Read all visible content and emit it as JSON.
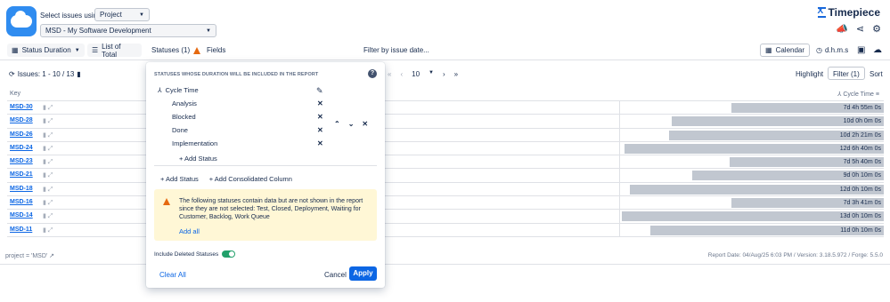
{
  "header": {
    "select_label": "Select issues using",
    "source_select": "Project",
    "project_select": "MSD - My Software Development",
    "brand": "Timepiece"
  },
  "toolbar": {
    "status_duration": "Status Duration",
    "list_of_total": "List of Total",
    "statuses": "Statuses (1)",
    "fields": "Fields",
    "filter_date": "Filter by issue date...",
    "calendar": "Calendar",
    "dhms": "d.h.m.s"
  },
  "issuesbar": {
    "issues": "Issues: 1 - 10 / 13",
    "page_size": "10",
    "highlight": "Highlight",
    "filter": "Filter (1)",
    "sort": "Sort"
  },
  "table": {
    "col_key": "Key",
    "col_cycle": "Cycle Time",
    "rows": [
      {
        "key": "MSD-30",
        "value": "7d 4h 55m 0s",
        "fraction": 0.58
      },
      {
        "key": "MSD-28",
        "value": "10d 0h 0m 0s",
        "fraction": 0.81
      },
      {
        "key": "MSD-26",
        "value": "10d 2h 21m 0s",
        "fraction": 0.82
      },
      {
        "key": "MSD-24",
        "value": "12d 6h 40m 0s",
        "fraction": 0.99
      },
      {
        "key": "MSD-23",
        "value": "7d 5h 40m 0s",
        "fraction": 0.59
      },
      {
        "key": "MSD-21",
        "value": "9d 0h 10m 0s",
        "fraction": 0.73
      },
      {
        "key": "MSD-18",
        "value": "12d 0h 10m 0s",
        "fraction": 0.97
      },
      {
        "key": "MSD-16",
        "value": "7d 3h 41m 0s",
        "fraction": 0.58
      },
      {
        "key": "MSD-14",
        "value": "13d 0h 10m 0s",
        "fraction": 1.0
      },
      {
        "key": "MSD-11",
        "value": "11d 0h 10m 0s",
        "fraction": 0.89
      }
    ]
  },
  "footer": {
    "left": "project = 'MSD'",
    "right": "Report Date: 04/Aug/25 6:03 PM / Version: 3.18.5.972 / Forge: 5.5.0"
  },
  "popup": {
    "title": "STATUSES WHOSE DURATION WILL BE INCLUDED IN THE REPORT",
    "group": "Cycle Time",
    "statuses": [
      "Analysis",
      "Blocked",
      "Done",
      "Implementation"
    ],
    "add_status_inner": "+ Add Status",
    "add_status": "+ Add Status",
    "add_consolidated": "+ Add Consolidated Column",
    "warning": "The following statuses contain data but are not shown in the report since they are not selected: Test, Closed, Deployment, Waiting for Customer, Backlog, Work Queue",
    "add_all": "Add all",
    "include_deleted": "Include Deleted Statuses",
    "clear_all": "Clear All",
    "cancel": "Cancel",
    "apply": "Apply"
  },
  "colors": {
    "accent": "#0c66e4",
    "bar": "#c1c7d0",
    "warning_bg": "#fff7d6",
    "toggle_on": "#22a06b"
  }
}
